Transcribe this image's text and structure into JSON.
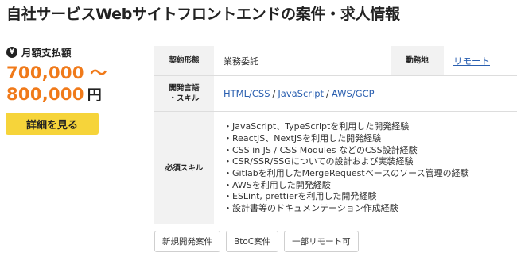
{
  "header": {
    "title": "自社サービスWebサイトフロントエンドの案件・求人情報"
  },
  "payment": {
    "icon": "yen-icon",
    "icon_glyph": "¥",
    "label": "月額支払額",
    "price_line1": "700,000 〜",
    "price_line2": "800,000",
    "unit": "円",
    "accent_color": "#f07a1a"
  },
  "detail_button": {
    "label": "詳細を見る",
    "color": "#f6d43a"
  },
  "info": {
    "contract_label": "契約形態",
    "contract_value": "業務委託",
    "location_label": "勤務地",
    "location_value": "リモート",
    "skills_label_line1": "開発言語",
    "skills_label_line2": "・スキル",
    "skills": [
      "HTML/CSS",
      "JavaScript",
      "AWS/GCP"
    ],
    "skills_separator": "/",
    "required_label": "必須スキル",
    "required": [
      "・JavaScript、TypeScriptを利用した開発経験",
      "・ReactJS、NextJSを利用した開発経験",
      "・CSS in JS / CSS Modules などのCSS設計経験",
      "・CSR/SSR/SSGについての設計および実装経験",
      "・Gitlabを利用したMergeRequestベースのソース管理の経験",
      "・AWSを利用した開発経験",
      "・ESLint, prettierを利用した開発経験",
      "・設計書等のドキュメンテーション作成経験"
    ]
  },
  "tags": [
    "新規開発案件",
    "BtoC案件",
    "一部リモート可"
  ]
}
